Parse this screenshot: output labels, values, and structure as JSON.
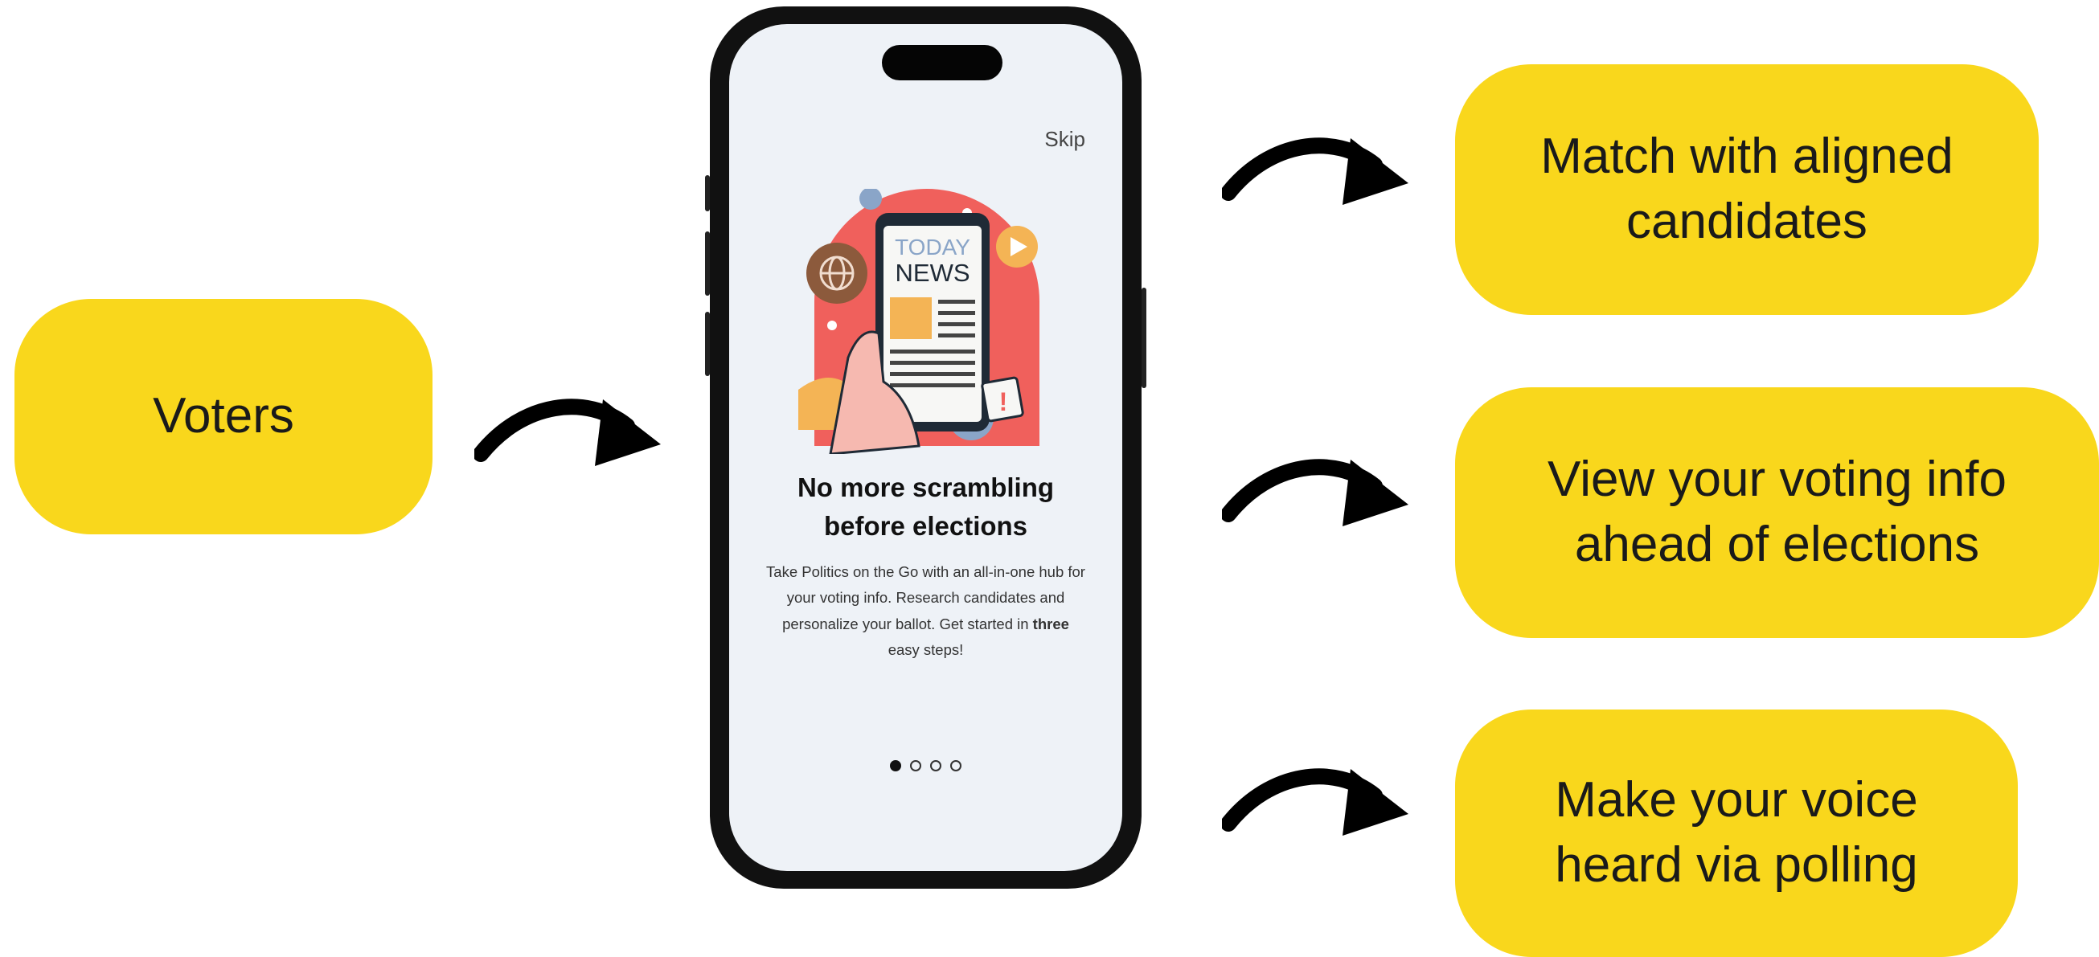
{
  "source": {
    "label": "Voters"
  },
  "features": [
    {
      "label": "Match with aligned\ncandidates"
    },
    {
      "label": "View your voting info\nahead of elections"
    },
    {
      "label": "Make your voice\nheard via polling"
    }
  ],
  "phone": {
    "skip_label": "Skip",
    "illustration": {
      "top_text": "TODAY",
      "bottom_text": "NEWS"
    },
    "headline": "No more scrambling\nbefore elections",
    "description_before": "Take Politics on the Go with an all-in-one hub for your voting info. Research candidates and personalize your ballot. Get started in ",
    "description_bold": "three",
    "description_after": " easy steps!",
    "pagination": {
      "total": 4,
      "active": 1
    }
  },
  "colors": {
    "pill": "#f9d71c",
    "screen": "#eef2f7",
    "illustration_bg": "#f0605c"
  }
}
